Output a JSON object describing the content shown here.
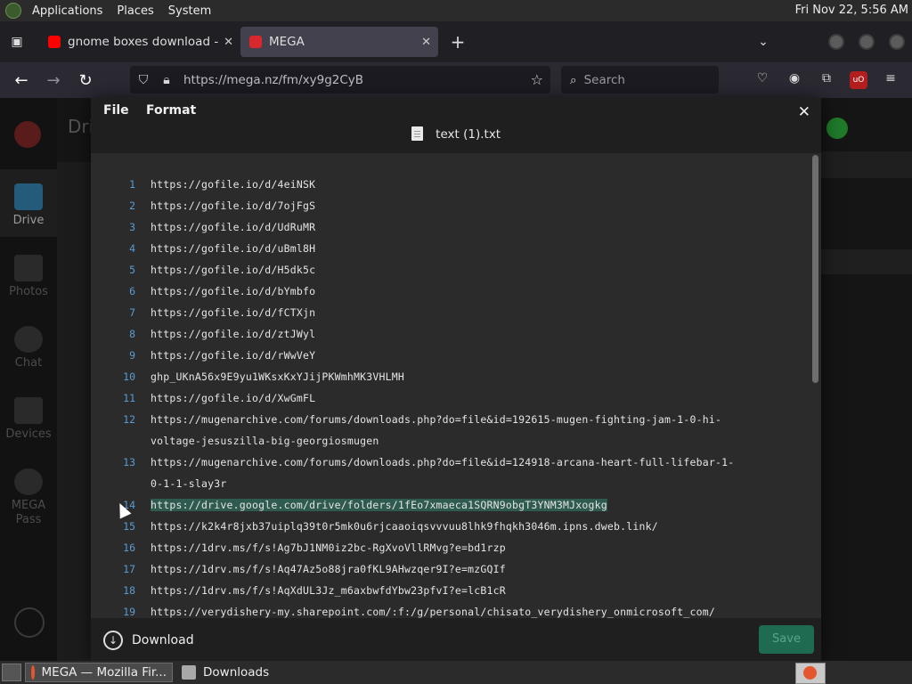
{
  "panel": {
    "applications": "Applications",
    "places": "Places",
    "system": "System",
    "clock": "Fri Nov 22,  5:56 AM"
  },
  "tabs": [
    {
      "title": "gnome boxes download - Yo",
      "favicon_color": "#ff0000"
    },
    {
      "title": "MEGA",
      "favicon_color": "#d9272e"
    }
  ],
  "nav": {
    "url": "https://mega.nz/fm/xy9g2CyB",
    "search_placeholder": "Search"
  },
  "mega_bg": {
    "header": "Drive",
    "rail": [
      "Drive",
      "Photos",
      "Chat",
      "Devices",
      "MEGA Pass"
    ]
  },
  "dialog": {
    "menu": {
      "file": "File",
      "format": "Format"
    },
    "filename": "text (1).txt",
    "download": "Download",
    "save": "Save",
    "selected_line": 14,
    "lines": [
      {
        "n": "1",
        "text": "https://gofile.io/d/4eiNSK"
      },
      {
        "n": "2",
        "text": "https://gofile.io/d/7ojFgS"
      },
      {
        "n": "3",
        "text": "https://gofile.io/d/UdRuMR"
      },
      {
        "n": "4",
        "text": "https://gofile.io/d/uBml8H"
      },
      {
        "n": "5",
        "text": "https://gofile.io/d/H5dk5c"
      },
      {
        "n": "6",
        "text": "https://gofile.io/d/bYmbfo"
      },
      {
        "n": "7",
        "text": "https://gofile.io/d/fCTXjn"
      },
      {
        "n": "8",
        "text": "https://gofile.io/d/ztJWyl"
      },
      {
        "n": "9",
        "text": "https://gofile.io/d/rWwVeY"
      },
      {
        "n": "10",
        "text": "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"
      },
      {
        "n": "11",
        "text": "https://gofile.io/d/XwGmFL"
      },
      {
        "n": "12",
        "text": "https://mugenarchive.com/forums/downloads.php?do=file&id=192615-mugen-fighting-jam-1-0-hi-voltage-jesuszilla-big-georgiosmugen"
      },
      {
        "n": "13",
        "text": "https://mugenarchive.com/forums/downloads.php?do=file&id=124918-arcana-heart-full-lifebar-1-0-1-1-slay3r"
      },
      {
        "n": "14",
        "text": "https://drive.google.com/drive/folders/1fEo7xmaeca1SQRN9obgT3YNM3MJxogkg"
      },
      {
        "n": "15",
        "text": "https://k2k4r8jxb37uiplq39t0r5mk0u6rjcaaoiqsvvvuu8lhk9fhqkh3046m.ipns.dweb.link/"
      },
      {
        "n": "16",
        "text": "https://1drv.ms/f/s!Ag7bJ1NM0iz2bc-RgXvoVllRMvg?e=bd1rzp"
      },
      {
        "n": "17",
        "text": "https://1drv.ms/f/s!Aq47Az5o88jra0fKL9AHwzqer9I?e=mzGQIf"
      },
      {
        "n": "18",
        "text": "https://1drv.ms/f/s!AqXdUL3Jz_m6axbwfdYbw23pfvI?e=lcB1cR"
      },
      {
        "n": "19",
        "text": "https://verydishery-my.sharepoint.com/:f:/g/personal/chisato_verydishery_onmicrosoft_com/"
      }
    ]
  },
  "taskbar": {
    "items": [
      "MEGA — Mozilla Fir...",
      "Downloads"
    ]
  }
}
